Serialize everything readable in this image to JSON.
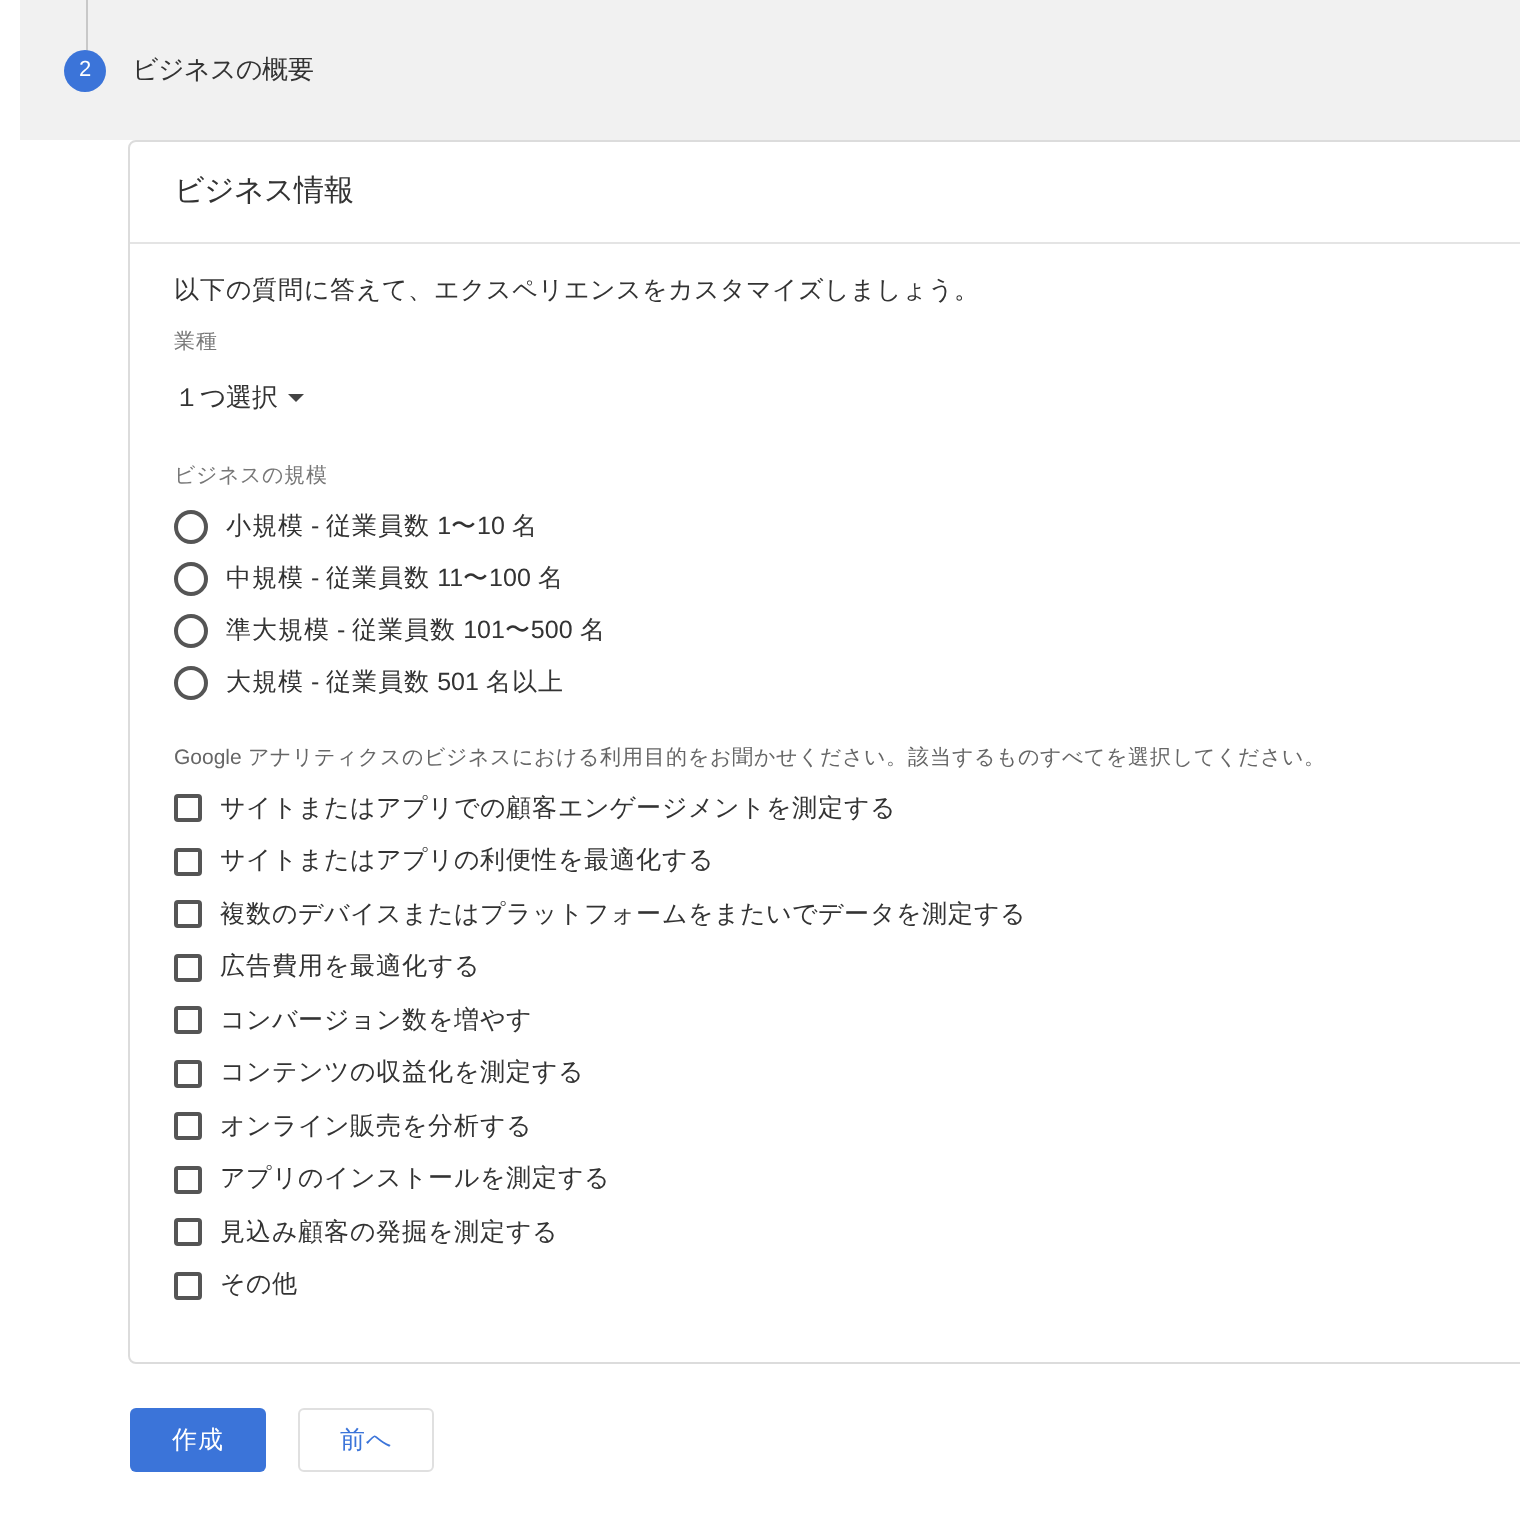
{
  "step": {
    "number": "2",
    "title": "ビジネスの概要"
  },
  "card": {
    "title": "ビジネス情報",
    "intro": "以下の質問に答えて、エクスペリエンスをカスタマイズしましょう。",
    "industry": {
      "label": "業種",
      "value": "１つ選択"
    },
    "size": {
      "label": "ビジネスの規模",
      "options": [
        {
          "label": "小規模 - 従業員数 1〜10 名",
          "selected": false
        },
        {
          "label": "中規模 - 従業員数 11〜100 名",
          "selected": false
        },
        {
          "label": "準大規模 - 従業員数 101〜500 名",
          "selected": false
        },
        {
          "label": "大規模 - 従業員数 501 名以上",
          "selected": false
        }
      ]
    },
    "purposes": {
      "label": "Google アナリティクスのビジネスにおける利用目的をお聞かせください。該当するものすべてを選択してください。",
      "options": [
        {
          "label": "サイトまたはアプリでの顧客エンゲージメントを測定する",
          "checked": false
        },
        {
          "label": "サイトまたはアプリの利便性を最適化する",
          "checked": false
        },
        {
          "label": "複数のデバイスまたはプラットフォームをまたいでデータを測定する",
          "checked": false
        },
        {
          "label": "広告費用を最適化する",
          "checked": false
        },
        {
          "label": "コンバージョン数を増やす",
          "checked": false
        },
        {
          "label": "コンテンツの収益化を測定する",
          "checked": false
        },
        {
          "label": "オンライン販売を分析する",
          "checked": false
        },
        {
          "label": "アプリのインストールを測定する",
          "checked": false
        },
        {
          "label": "見込み顧客の発掘を測定する",
          "checked": false
        },
        {
          "label": "その他",
          "checked": false
        }
      ]
    }
  },
  "buttons": [
    {
      "label": "作成",
      "kind": "primary"
    },
    {
      "label": "前へ",
      "kind": "secondary"
    }
  ]
}
